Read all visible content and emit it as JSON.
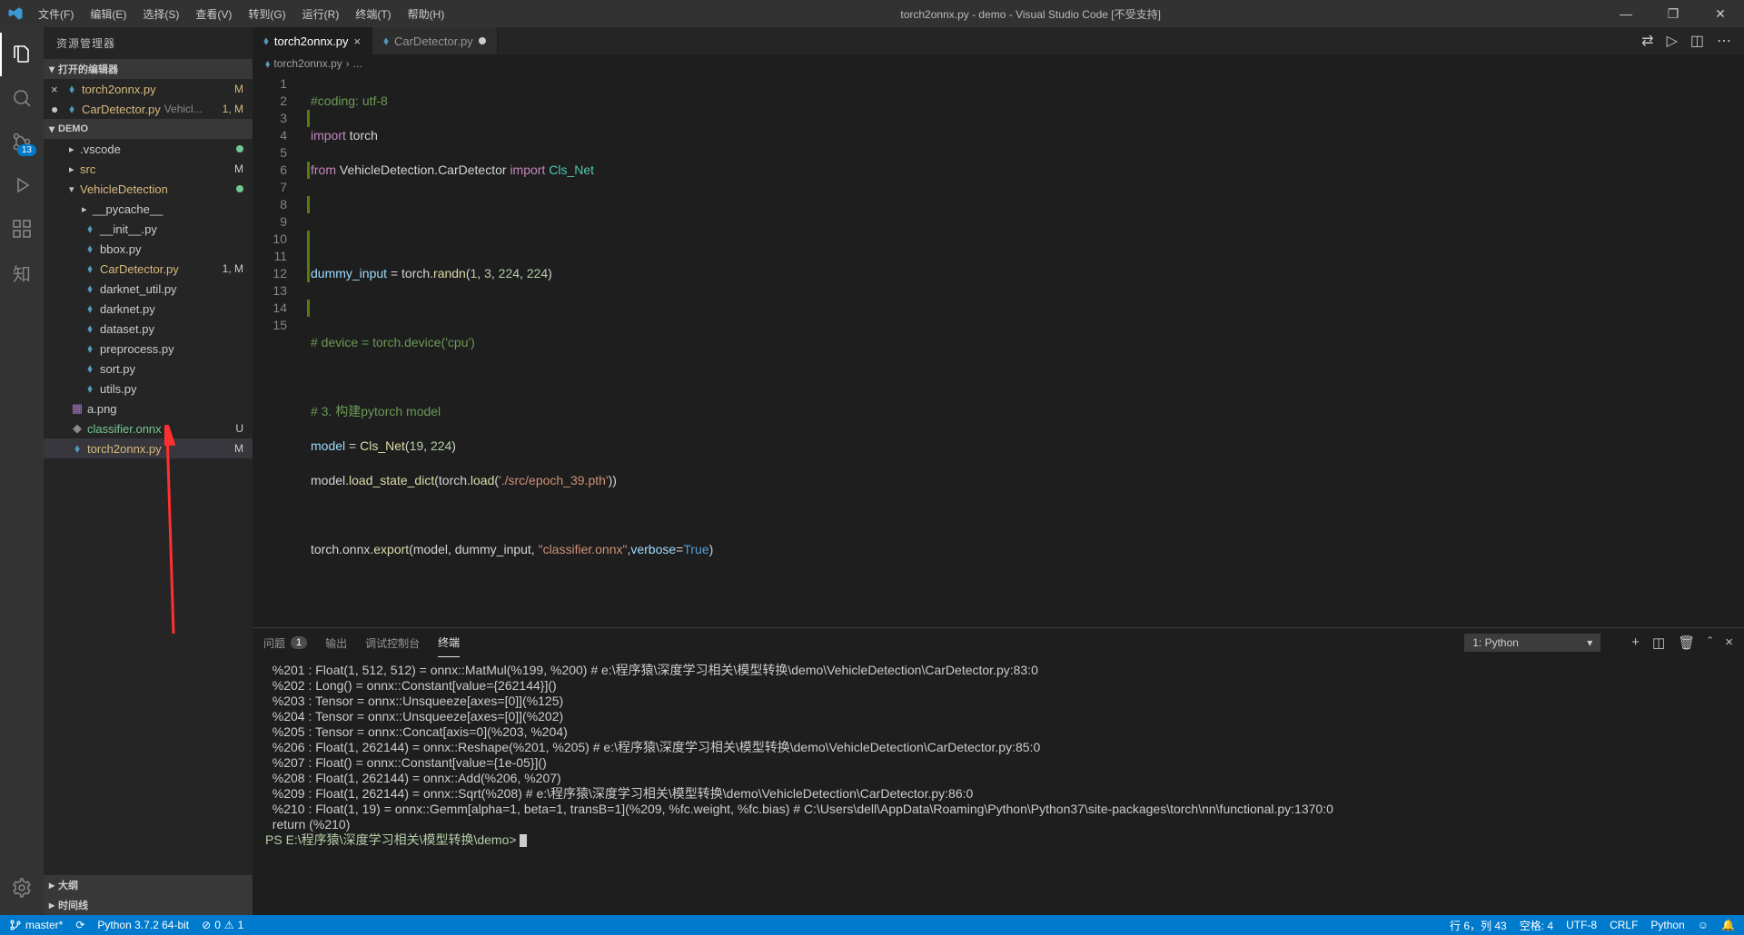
{
  "title": "torch2onnx.py - demo - Visual Studio Code [不受支持]",
  "menu": [
    "文件(F)",
    "编辑(E)",
    "选择(S)",
    "查看(V)",
    "转到(G)",
    "运行(R)",
    "终端(T)",
    "帮助(H)"
  ],
  "activitybar": {
    "scm_badge": "13"
  },
  "explorer": {
    "title": "资源管理器",
    "open_editors_label": "打开的编辑器",
    "open_editors": [
      {
        "name": "torch2onnx.py",
        "status": "M",
        "close": true
      },
      {
        "name": "CarDetector.py",
        "path": "Vehicl...",
        "status": "1, M"
      }
    ],
    "workspace_label": "DEMO",
    "tree": [
      {
        "type": "dir",
        "name": ".vscode",
        "indent": 1,
        "dot": "green"
      },
      {
        "type": "dir",
        "name": "src",
        "indent": 1,
        "status": "M",
        "mod": true
      },
      {
        "type": "dir",
        "name": "VehicleDetection",
        "indent": 1,
        "expanded": true,
        "dot": "green",
        "mod": true
      },
      {
        "type": "dir",
        "name": "__pycache__",
        "indent": 2
      },
      {
        "type": "file",
        "name": "__init__.py",
        "indent": 2,
        "py": true
      },
      {
        "type": "file",
        "name": "bbox.py",
        "indent": 2,
        "py": true
      },
      {
        "type": "file",
        "name": "CarDetector.py",
        "indent": 2,
        "py": true,
        "status": "1, M",
        "mod": true
      },
      {
        "type": "file",
        "name": "darknet_util.py",
        "indent": 2,
        "py": true
      },
      {
        "type": "file",
        "name": "darknet.py",
        "indent": 2,
        "py": true
      },
      {
        "type": "file",
        "name": "dataset.py",
        "indent": 2,
        "py": true
      },
      {
        "type": "file",
        "name": "preprocess.py",
        "indent": 2,
        "py": true
      },
      {
        "type": "file",
        "name": "sort.py",
        "indent": 2,
        "py": true
      },
      {
        "type": "file",
        "name": "utils.py",
        "indent": 2,
        "py": true
      },
      {
        "type": "file",
        "name": "a.png",
        "indent": 1,
        "icon": "img"
      },
      {
        "type": "file",
        "name": "classifier.onnx",
        "indent": 1,
        "status": "U",
        "untracked": true
      },
      {
        "type": "file",
        "name": "torch2onnx.py",
        "indent": 1,
        "py": true,
        "status": "M",
        "mod": true,
        "selected": true
      }
    ],
    "outline_label": "大纲",
    "timeline_label": "时间线"
  },
  "editor": {
    "tabs": [
      {
        "label": "torch2onnx.py",
        "active": true,
        "dirty": false
      },
      {
        "label": "CarDetector.py",
        "active": false,
        "dirty": true
      }
    ],
    "breadcrumb": {
      "file": "torch2onnx.py",
      "sep": "›",
      "rest": "..."
    },
    "line_numbers": [
      "1",
      "2",
      "3",
      "4",
      "5",
      "6",
      "7",
      "8",
      "9",
      "10",
      "11",
      "12",
      "13",
      "14",
      "15"
    ],
    "marks": [
      "",
      "",
      "m",
      "",
      "",
      "m",
      "",
      "m",
      "",
      "m",
      "m",
      "m",
      "",
      "m",
      ""
    ]
  },
  "code": {
    "l1": "#coding: utf-8",
    "l2_import": "import",
    "l2_torch": " torch",
    "l3_from": "from",
    "l3_pkg": " VehicleDetection.CarDetector ",
    "l3_import": "import",
    "l3_cls": " Cls_Net",
    "l6_a": "dummy_input ",
    "l6_eq": "= ",
    "l6_b": "torch.",
    "l6_fn": "randn",
    "l6_p1": "(",
    "l6_n1": "1",
    "l6_c": ", ",
    "l6_n2": "3",
    "l6_n3": "224",
    "l6_n4": "224",
    "l6_p2": ")",
    "l8": "# device = torch.device('cpu')",
    "l10": "# 3. 构建pytorch model",
    "l11_a": "model ",
    "l11_eq": "= ",
    "l11_fn": "Cls_Net",
    "l11_p1": "(",
    "l11_n1": "19",
    "l11_c": ", ",
    "l11_n2": "224",
    "l11_p2": ")",
    "l12_a": "model.",
    "l12_fn1": "load_state_dict",
    "l12_p1": "(",
    "l12_b": "torch.",
    "l12_fn2": "load",
    "l12_p2": "(",
    "l12_s": "'./src/epoch_39.pth'",
    "l12_p3": "))",
    "l14_a": "torch.onnx.",
    "l14_fn": "export",
    "l14_p1": "(",
    "l14_b": "model, dummy_input, ",
    "l14_s": "\"classifier.onnx\"",
    "l14_c": ",",
    "l14_kw": "verbose",
    "l14_eq": "=",
    "l14_true": "True",
    "l14_p2": ")"
  },
  "panel": {
    "tabs": {
      "problems": "问题",
      "problems_badge": "1",
      "output": "输出",
      "debug": "调试控制台",
      "terminal": "终端"
    },
    "dropdown": "1: Python",
    "terminal_lines": [
      "  %201 : Float(1, 512, 512) = onnx::MatMul(%199, %200) # e:\\程序猿\\深度学习相关\\模型转换\\demo\\VehicleDetection\\CarDetector.py:83:0",
      "  %202 : Long() = onnx::Constant[value={262144}]()",
      "  %203 : Tensor = onnx::Unsqueeze[axes=[0]](%125)",
      "  %204 : Tensor = onnx::Unsqueeze[axes=[0]](%202)",
      "  %205 : Tensor = onnx::Concat[axis=0](%203, %204)",
      "  %206 : Float(1, 262144) = onnx::Reshape(%201, %205) # e:\\程序猿\\深度学习相关\\模型转换\\demo\\VehicleDetection\\CarDetector.py:85:0",
      "  %207 : Float() = onnx::Constant[value={1e-05}]()",
      "  %208 : Float(1, 262144) = onnx::Add(%206, %207)",
      "  %209 : Float(1, 262144) = onnx::Sqrt(%208) # e:\\程序猿\\深度学习相关\\模型转换\\demo\\VehicleDetection\\CarDetector.py:86:0",
      "  %210 : Float(1, 19) = onnx::Gemm[alpha=1, beta=1, transB=1](%209, %fc.weight, %fc.bias) # C:\\Users\\dell\\AppData\\Roaming\\Python\\Python37\\site-packages\\torch\\nn\\functional.py:1370:0",
      "  return (%210)",
      "",
      "PS E:\\程序猿\\深度学习相关\\模型转换\\demo> "
    ]
  },
  "statusbar": {
    "branch": "master*",
    "sync": "⟳",
    "python": "Python 3.7.2 64-bit",
    "errors": "0",
    "warnings": "1",
    "ln_col": "行 6，列 43",
    "spaces": "空格: 4",
    "encoding": "UTF-8",
    "eol": "CRLF",
    "lang": "Python",
    "feedback": "☺"
  }
}
